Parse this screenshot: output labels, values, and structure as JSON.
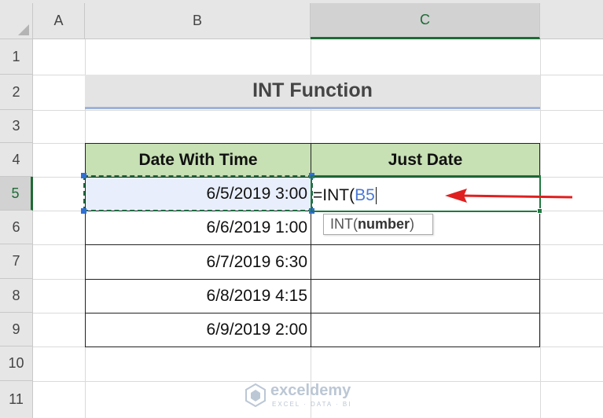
{
  "columns": [
    "A",
    "B",
    "C"
  ],
  "rows": [
    "1",
    "2",
    "3",
    "4",
    "5",
    "6",
    "7",
    "8",
    "9",
    "10",
    "11"
  ],
  "title": "INT Function",
  "table": {
    "headers": [
      "Date With Time",
      "Just Date"
    ],
    "rows": [
      {
        "date_time": "6/5/2019 3:00",
        "just_date": ""
      },
      {
        "date_time": "6/6/2019 1:00",
        "just_date": ""
      },
      {
        "date_time": "6/7/2019 6:30",
        "just_date": ""
      },
      {
        "date_time": "6/8/2019 4:15",
        "just_date": ""
      },
      {
        "date_time": "6/9/2019 2:00",
        "just_date": ""
      }
    ]
  },
  "formula_edit": {
    "prefix": "=INT(",
    "reference": "B5"
  },
  "tooltip": {
    "function_name": "INT(",
    "argument": "number",
    "suffix": ")"
  },
  "watermark": {
    "name": "exceldemy",
    "tagline": "EXCEL · DATA · BI"
  },
  "colors": {
    "header_fill": "#c7e0b4",
    "accent_green": "#1f7a3f",
    "arrow_red": "#e02020",
    "reference_blue": "#4a78d6"
  },
  "icons": [
    "arrow-pointer-icon",
    "exceldemy-logo-icon",
    "select-all-triangle-icon"
  ]
}
